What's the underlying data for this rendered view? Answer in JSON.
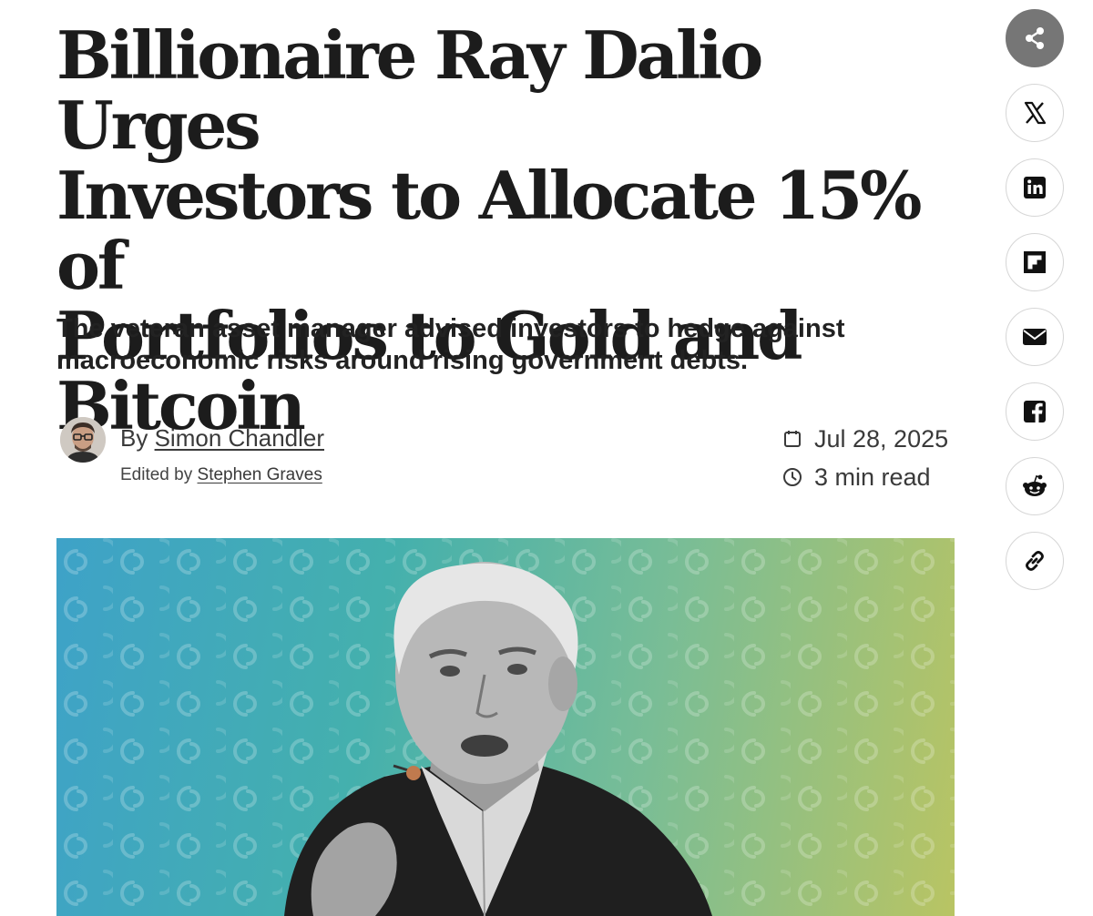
{
  "article": {
    "headline_lines": [
      "Billionaire Ray Dalio Urges",
      "Investors to Allocate 15% of",
      "Portfolios to Gold and",
      "Bitcoin"
    ],
    "subhead_lines": [
      "The veteran asset manager advised investors to hedge against",
      "macroeconomic risks around rising government debts."
    ],
    "byline": {
      "by_prefix": "By",
      "author": "Simon Chandler",
      "edited_prefix": "Edited by",
      "editor": "Stephen Graves"
    },
    "meta": {
      "date": "Jul 28, 2025",
      "read_time": "3 min read"
    }
  },
  "share_rail": {
    "buttons": [
      {
        "icon": "share-icon"
      },
      {
        "icon": "x-icon"
      },
      {
        "icon": "linkedin-icon"
      },
      {
        "icon": "flipboard-icon"
      },
      {
        "icon": "email-icon"
      },
      {
        "icon": "facebook-icon"
      },
      {
        "icon": "reddit-icon"
      },
      {
        "icon": "link-icon"
      }
    ]
  },
  "colors": {
    "hero_gradient": [
      "#3ea2c8",
      "#44b0ad",
      "#79bd96",
      "#b9c463"
    ],
    "share_primary": "#767676"
  }
}
